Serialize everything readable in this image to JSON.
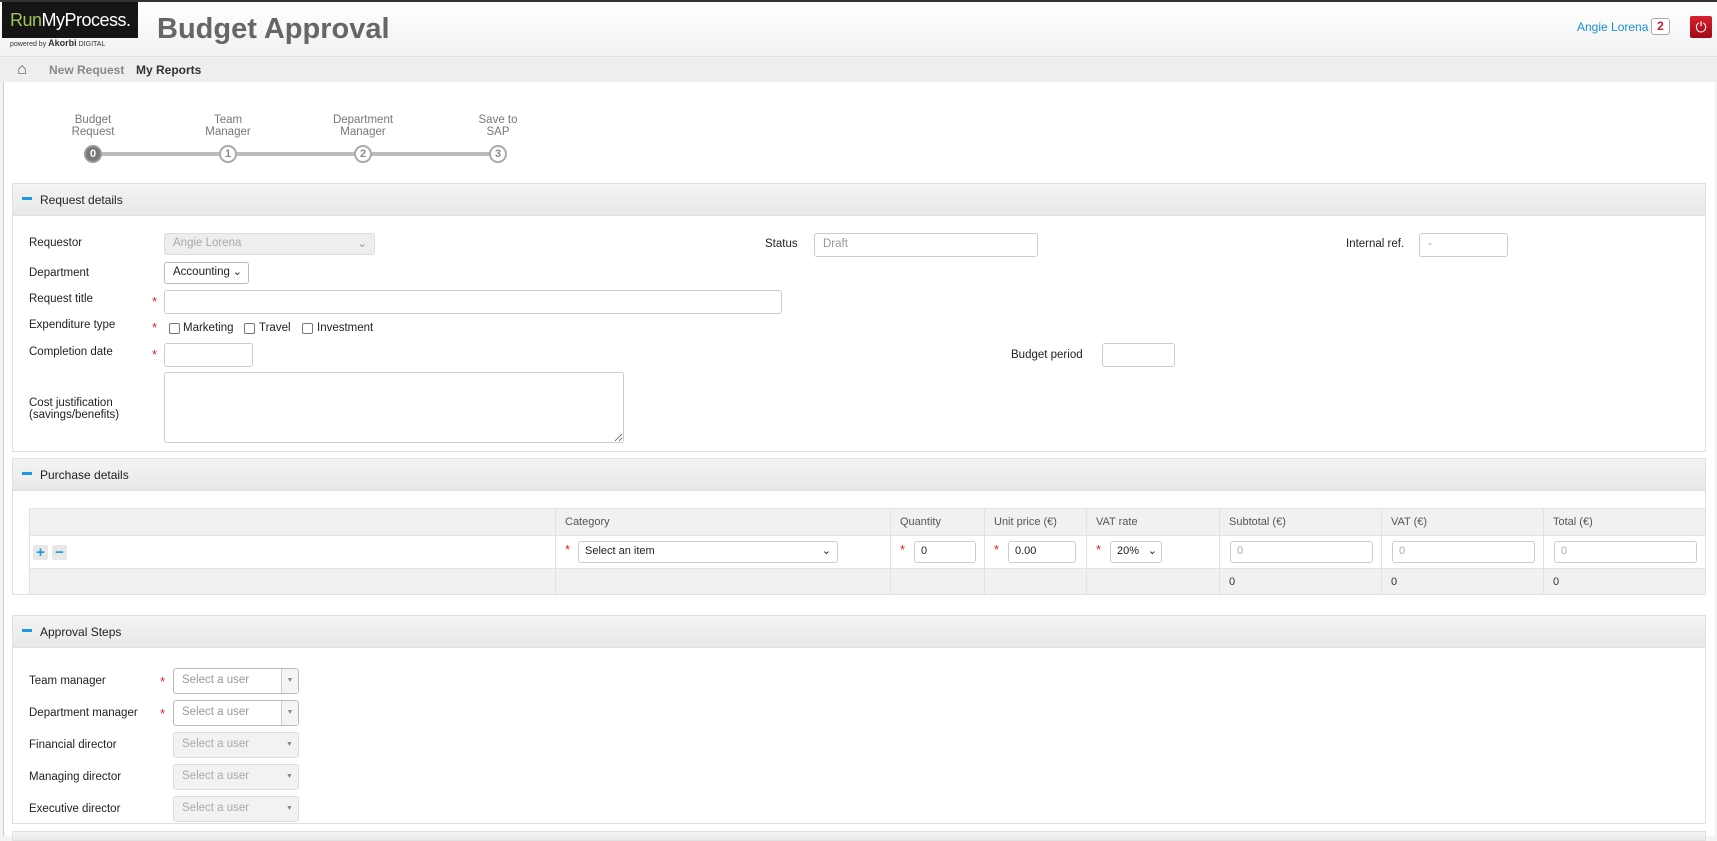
{
  "header": {
    "logo_run": "Run",
    "logo_rest": "MyProcess.",
    "powered_by": "powered by",
    "powered_brand": "Akorbi",
    "powered_suffix": "DIGITAL",
    "app_title": "Budget Approval",
    "user_name": "Angie Lorena",
    "notification_count": "2",
    "power_icon": "power-icon"
  },
  "nav": {
    "home_icon": "home-icon",
    "items": [
      {
        "label": "New Request"
      },
      {
        "label": "My Reports"
      }
    ]
  },
  "steps": [
    {
      "label": "Budget\nRequest",
      "number": "0",
      "active": true
    },
    {
      "label": "Team\nManager",
      "number": "1",
      "active": false
    },
    {
      "label": "Department\nManager",
      "number": "2",
      "active": false
    },
    {
      "label": "Save to\nSAP",
      "number": "3",
      "active": false
    }
  ],
  "request_details": {
    "title": "Request details",
    "requestor_label": "Requestor",
    "requestor_value": "Angie Lorena",
    "status_label": "Status",
    "status_value": "Draft",
    "internal_ref_label": "Internal ref.",
    "internal_ref_value": "-",
    "department_label": "Department",
    "department_value": "Accounting",
    "request_title_label": "Request title",
    "request_title_value": "",
    "expenditure_label": "Expenditure type",
    "expenditure_options": [
      "Marketing",
      "Travel",
      "Investment"
    ],
    "completion_label": "Completion date",
    "completion_value": "",
    "budget_period_label": "Budget period",
    "budget_period_value": "",
    "cost_label_1": "Cost justification",
    "cost_label_2": "(savings/benefits)",
    "cost_value": ""
  },
  "purchase_details": {
    "title": "Purchase details",
    "columns": [
      "Category",
      "Quantity",
      "Unit price (€)",
      "VAT rate",
      "Subtotal (€)",
      "VAT (€)",
      "Total (€)"
    ],
    "row": {
      "category": "Select an item",
      "quantity": "0",
      "unit_price": "0.00",
      "vat_rate": "20%",
      "subtotal": "0",
      "vat": "0",
      "total": "0"
    },
    "totals": {
      "subtotal": "0",
      "vat": "0",
      "total": "0"
    }
  },
  "approval_steps": {
    "title": "Approval Steps",
    "placeholder": "Select a user",
    "items": [
      {
        "label": "Team manager",
        "required": true
      },
      {
        "label": "Department manager",
        "required": true
      },
      {
        "label": "Financial director",
        "required": false
      },
      {
        "label": "Managing director",
        "required": false
      },
      {
        "label": "Executive director",
        "required": false
      }
    ]
  },
  "colors": {
    "accent": "#1a9be0",
    "link": "#1a8fd0",
    "danger": "#c01e2e",
    "required": "#e02020"
  }
}
